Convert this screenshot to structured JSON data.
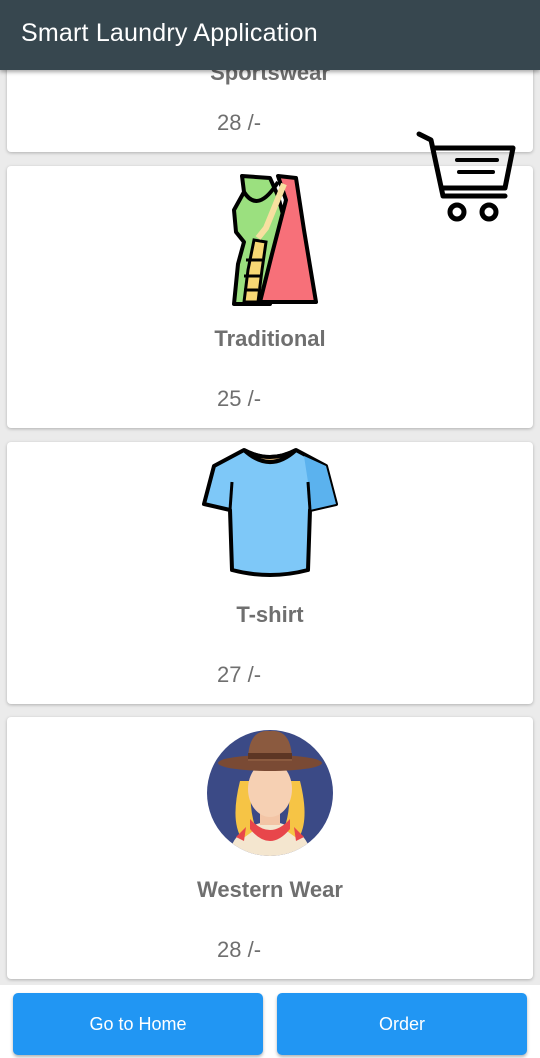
{
  "appbar": {
    "title": "Smart Laundry Application"
  },
  "cart": {
    "icon": "shopping-cart-icon"
  },
  "items": [
    {
      "name": "Sportswear",
      "price": "28 /-",
      "icon": "sportswear-icon"
    },
    {
      "name": "Traditional",
      "price": "25 /-",
      "icon": "saree-icon"
    },
    {
      "name": "T-shirt",
      "price": "27 /-",
      "icon": "tshirt-icon"
    },
    {
      "name": "Western Wear",
      "price": "28 /-",
      "icon": "cowgirl-avatar-icon"
    }
  ],
  "buttons": {
    "home": "Go to Home",
    "order": "Order"
  },
  "colors": {
    "appbar": "#37474f",
    "button": "#2196f3",
    "text": "#6f6f6f"
  }
}
